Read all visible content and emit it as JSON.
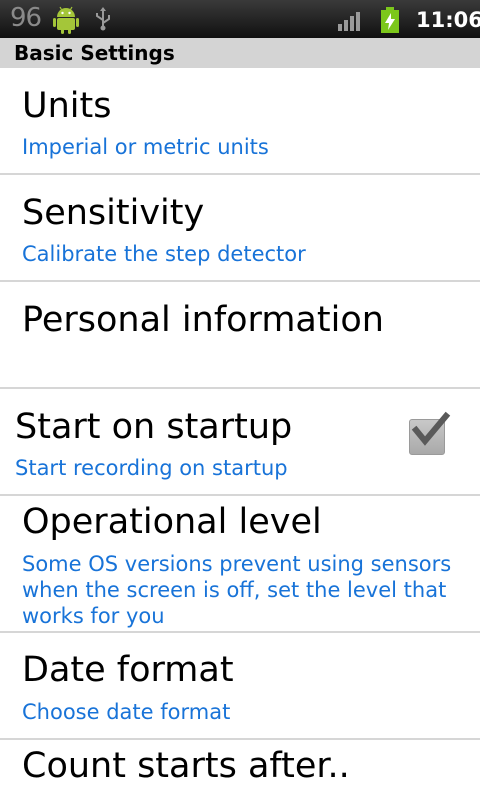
{
  "status_bar": {
    "notification_count": "96",
    "time": "11:06",
    "icons": [
      "android-icon",
      "usb-icon",
      "signal-icon",
      "battery-charging-icon"
    ]
  },
  "section": {
    "title": "Basic Settings"
  },
  "preferences": [
    {
      "title": "Units",
      "summary": "Imperial or metric units"
    },
    {
      "title": "Sensitivity",
      "summary": "Calibrate the step detector"
    },
    {
      "title": "Personal information",
      "summary": ""
    },
    {
      "title": "Start on startup",
      "summary": "Start recording on startup",
      "checked": true
    },
    {
      "title": "Operational level",
      "summary": [
        "Some OS versions prevent using sensors",
        "when the screen is off, set the level that",
        "works for you"
      ]
    },
    {
      "title": "Date format",
      "summary": "Choose date format"
    },
    {
      "title": "Count starts after..",
      "summary": ""
    }
  ],
  "colors": {
    "summary_blue": "#1873d8",
    "status_bar": "#101010",
    "section_header": "#d4d4d4",
    "battery_green": "#7cc71b"
  }
}
